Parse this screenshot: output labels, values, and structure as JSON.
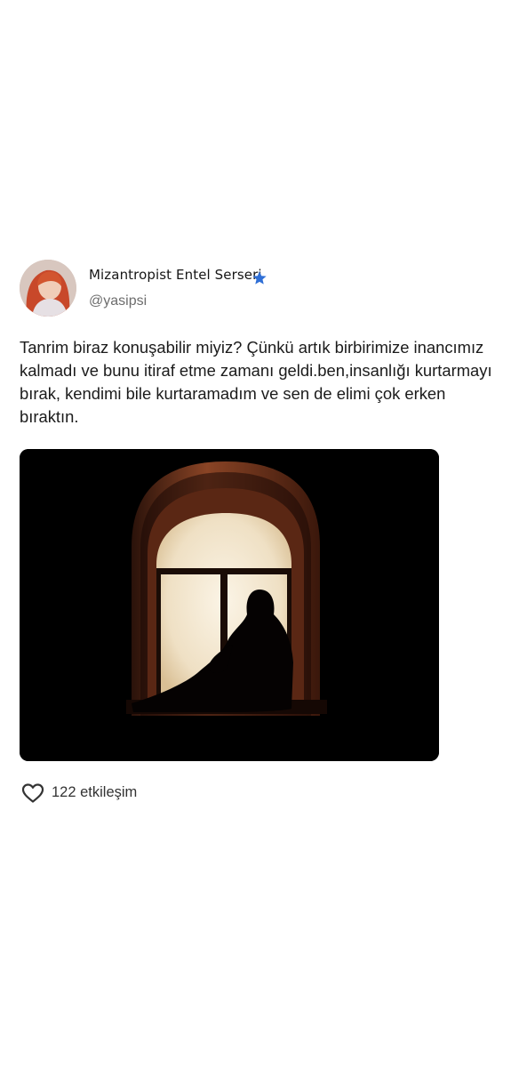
{
  "user": {
    "display_name": "Mizantropist Entel Serseri",
    "handle": "@yasipsi",
    "verified": true
  },
  "post": {
    "text_lines": [
      "Tanrim biraz konuşabilir miyiz? Çünkü artık birbirimize inancımız",
      "kalmadı ve bunu itiraf etme zamanı geldi.ben,insanlığı kurtarmayı",
      "bırak, kendimi bile kurtaramadım ve sen de elimi çok erken",
      "bıraktın."
    ]
  },
  "footer": {
    "engagement_label": "122 etkileşim"
  },
  "icons": {
    "verified": "verified-star-icon",
    "like": "heart-outline-icon"
  },
  "colors": {
    "verified": "#2f6fd6",
    "window_light": "#f4ead8",
    "brick": "#7a3a1e"
  }
}
